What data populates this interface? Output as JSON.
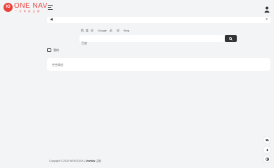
{
  "brand": {
    "mark": "IO",
    "name": "ONE NAV",
    "tagline": "一 为 导 航 主 题",
    "color": "#e9423a"
  },
  "header": {
    "menu_icon": "hamburger-icon",
    "user_icon": "user-icon"
  },
  "notice": {
    "speaker_icon": "megaphone-icon",
    "close_icon": "close-icon",
    "text": ""
  },
  "search": {
    "engines": [
      "百",
      "度",
      "谷",
      "Google",
      "必",
      "应",
      "Bing"
    ],
    "active_engine": "百",
    "placeholder": "百度",
    "button_icon": "search-icon"
  },
  "section": {
    "icon": "mail-icon",
    "title": "我的"
  },
  "card": {
    "text": "空空如也"
  },
  "footer": {
    "prefix": "Copyright © 2020 ",
    "site": "WEBSTACK",
    "sep": " | ",
    "theme": "OneNav",
    "suffix": " 主题"
  },
  "floating": [
    "chat-icon",
    "moon-icon",
    "arrow-up-icon"
  ]
}
